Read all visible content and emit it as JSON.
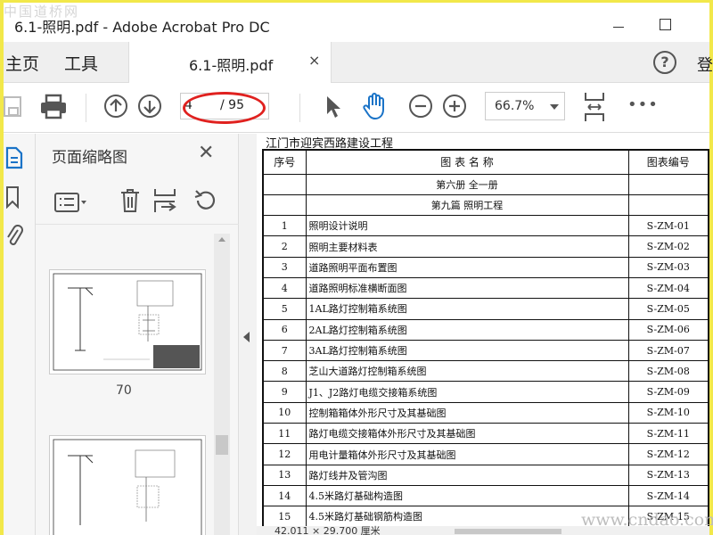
{
  "watermarks": {
    "top_left": "中国道桥网",
    "bottom_right": "www.cndao.com"
  },
  "window": {
    "title": "6.1-照明.pdf - Adobe Acrobat Pro DC"
  },
  "menu": {
    "home": "主页",
    "tools": "工具",
    "signin_partial": "登"
  },
  "tab": {
    "label": "6.1-照明.pdf",
    "close": "×"
  },
  "toolbar": {
    "current_page": "4",
    "total_pages": "/ 95",
    "zoom": "66.7%",
    "more": "•••"
  },
  "thumbnails": {
    "title": "页面缩略图",
    "items": [
      {
        "label": "70"
      },
      {
        "label": ""
      }
    ]
  },
  "document": {
    "project_header": "江门市迎宾西路建设工程",
    "columns": [
      "序号",
      "图 表 名 称",
      "图表编号"
    ],
    "section_rows": [
      "第六册 全一册",
      "第九篇 照明工程"
    ],
    "rows": [
      {
        "no": "1",
        "name": "照明设计说明",
        "code": "S-ZM-01"
      },
      {
        "no": "2",
        "name": "照明主要材料表",
        "code": "S-ZM-02"
      },
      {
        "no": "3",
        "name": "道路照明平面布置图",
        "code": "S-ZM-03"
      },
      {
        "no": "4",
        "name": "道路照明标准横断面图",
        "code": "S-ZM-04"
      },
      {
        "no": "5",
        "name": "1AL路灯控制箱系统图",
        "code": "S-ZM-05"
      },
      {
        "no": "6",
        "name": "2AL路灯控制箱系统图",
        "code": "S-ZM-06"
      },
      {
        "no": "7",
        "name": "3AL路灯控制箱系统图",
        "code": "S-ZM-07"
      },
      {
        "no": "8",
        "name": "芝山大道路灯控制箱系统图",
        "code": "S-ZM-08"
      },
      {
        "no": "9",
        "name": "J1、J2路灯电缆交接箱系统图",
        "code": "S-ZM-09"
      },
      {
        "no": "10",
        "name": "控制箱箱体外形尺寸及其基础图",
        "code": "S-ZM-10"
      },
      {
        "no": "11",
        "name": "路灯电缆交接箱体外形尺寸及其基础图",
        "code": "S-ZM-11"
      },
      {
        "no": "12",
        "name": "用电计量箱体外形尺寸及其基础图",
        "code": "S-ZM-12"
      },
      {
        "no": "13",
        "name": "路灯线井及管沟图",
        "code": "S-ZM-13"
      },
      {
        "no": "14",
        "name": "4.5米路灯基础构造图",
        "code": "S-ZM-14"
      },
      {
        "no": "15",
        "name": "4.5米路灯基础钢筋构造图",
        "code": "S-ZM-15"
      }
    ]
  },
  "status_bar": {
    "text_partial": "42.011 × 29.700 厘米"
  }
}
